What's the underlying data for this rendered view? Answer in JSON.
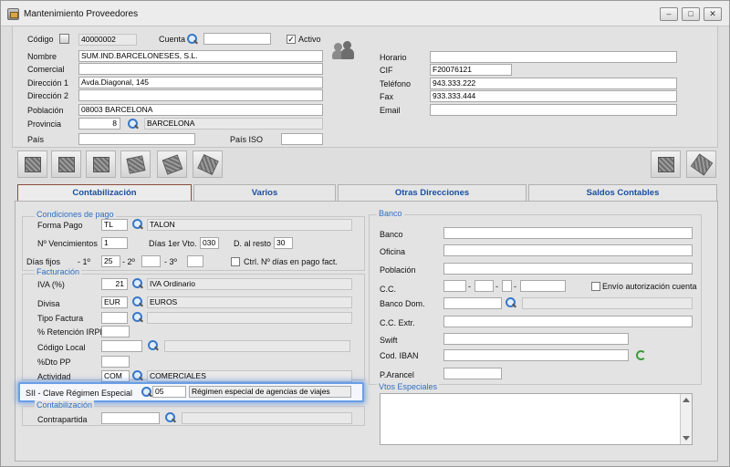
{
  "window": {
    "title": "Mantenimiento Proveedores"
  },
  "header": {
    "codigo_label": "Código",
    "codigo_value": "40000002",
    "cuenta_label": "Cuenta",
    "cuenta_value": "",
    "activo_label": "Activo",
    "activo_checked": true,
    "nombre_label": "Nombre",
    "nombre_value": "SUM.IND.BARCELONESES, S.L.",
    "comercial_label": "Comercial",
    "comercial_value": "",
    "direccion1_label": "Dirección 1",
    "direccion1_value": "Avda.Diagonal, 145",
    "direccion2_label": "Dirección 2",
    "direccion2_value": "",
    "poblacion_label": "Población",
    "poblacion_value": "08003 BARCELONA",
    "provincia_label": "Provincia",
    "provincia_code": "8",
    "provincia_name": "BARCELONA",
    "pais_label": "País",
    "pais_value": "",
    "pais_iso_label": "País ISO",
    "pais_iso_value": "",
    "horario_label": "Horario",
    "horario_value": "",
    "cif_label": "CIF",
    "cif_value": "F20076121",
    "telefono_label": "Teléfono",
    "telefono_value": "943.333.222",
    "fax_label": "Fax",
    "fax_value": "933.333.444",
    "email_label": "Email",
    "email_value": ""
  },
  "tabs": [
    "Contabilización",
    "Varios",
    "Otras Direcciones",
    "Saldos Contables"
  ],
  "condiciones": {
    "title": "Condiciones de pago",
    "forma_pago_label": "Forma Pago",
    "forma_pago_code": "TL",
    "forma_pago_name": "TALON",
    "n_venc_label": "Nº Vencimientos",
    "n_venc_value": "1",
    "dias_1er_label": "Días 1er Vto.",
    "dias_1er_value": "030",
    "d_resto_label": "D. al resto",
    "d_resto_value": "30",
    "dias_fijos_label": "Días fijos",
    "sep1": "- 1º",
    "dia1_value": "25",
    "sep2": "- 2º",
    "dia2_value": "",
    "sep3": "- 3º",
    "dia3_value": "",
    "ctrl_label": "Ctrl. Nº días en pago fact."
  },
  "facturacion": {
    "title": "Facturación",
    "iva_label": "IVA (%)",
    "iva_code": "21",
    "iva_name": "IVA Ordinario",
    "divisa_label": "Divisa",
    "divisa_code": "EUR",
    "divisa_name": "EUROS",
    "tipo_factura_label": "Tipo Factura",
    "tipo_factura_value": "",
    "retencion_label": "% Retención IRPF",
    "retencion_value": "",
    "codigo_local_label": "Código Local",
    "codigo_local_value": "",
    "dto_pp_label": "%Dto PP",
    "dto_pp_value": "",
    "actividad_label": "Actividad",
    "actividad_code": "COM",
    "actividad_name": "COMERCIALES",
    "sii_label": "SII - Clave Régimen Especial",
    "sii_code": "05",
    "sii_name": "Régimen especial de agencias de viajes"
  },
  "contabilizacion": {
    "title": "Contabilización",
    "contrapartida_label": "Contrapartida",
    "contrapartida_value": ""
  },
  "banco": {
    "title": "Banco",
    "banco_label": "Banco",
    "oficina_label": "Oficina",
    "poblacion_label": "Población",
    "cc_label": "C.C.",
    "dash": "-",
    "envio_label": "Envío autorización cuenta",
    "banco_dom_label": "Banco Dom.",
    "cc_extr_label": "C.C. Extr.",
    "swift_label": "Swift",
    "iban_label": "Cod. IBAN",
    "parancel_label": "P.Arancel"
  },
  "vtos": {
    "title": "Vtos Especiales"
  },
  "colors": {
    "accent": "#2e6fc2",
    "highlight": "#6a9ee8",
    "active_tab_border": "#8b4d3a"
  }
}
